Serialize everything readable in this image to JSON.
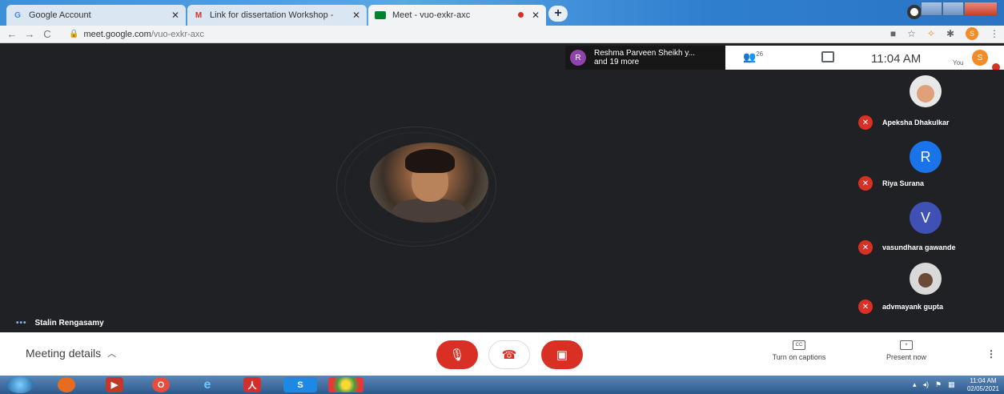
{
  "browser": {
    "tabs": [
      {
        "title": "Google Account",
        "favicon": "G"
      },
      {
        "title": "Link for dissertation Workshop -",
        "favicon": "M"
      },
      {
        "title": "Meet - vuo-exkr-axc",
        "favicon": "meet"
      }
    ],
    "url_host": "meet.google.com",
    "url_path": "/vuo-exkr-axc"
  },
  "meet": {
    "info_pill": {
      "avatar_letter": "R",
      "line1": "Reshma Parveen Sheikh y...",
      "line2": "and 19 more"
    },
    "people_count": "26",
    "time": "11:04 AM",
    "you_label": "You",
    "self_avatar": "S",
    "speaker_name": "Stalin Rengasamy",
    "participants": [
      {
        "name": "Apeksha Dhakulkar",
        "avatar": "photo",
        "color": "#e8e8e8"
      },
      {
        "name": "Riya Surana",
        "avatar": "R",
        "color": "#1a73e8"
      },
      {
        "name": "vasundhara gawande",
        "avatar": "V",
        "color": "#3f51b5"
      },
      {
        "name": "advmayank gupta",
        "avatar": "photo",
        "color": "#d9d9d9"
      }
    ]
  },
  "bottom": {
    "meeting_details": "Meeting details",
    "captions_label": "Turn on captions",
    "captions_icon": "CC",
    "present_label": "Present now"
  },
  "taskbar": {
    "time": "11:04 AM",
    "date": "02/05/2021"
  },
  "colors": {
    "accent_red": "#d93025",
    "meet_bg": "#202124"
  }
}
